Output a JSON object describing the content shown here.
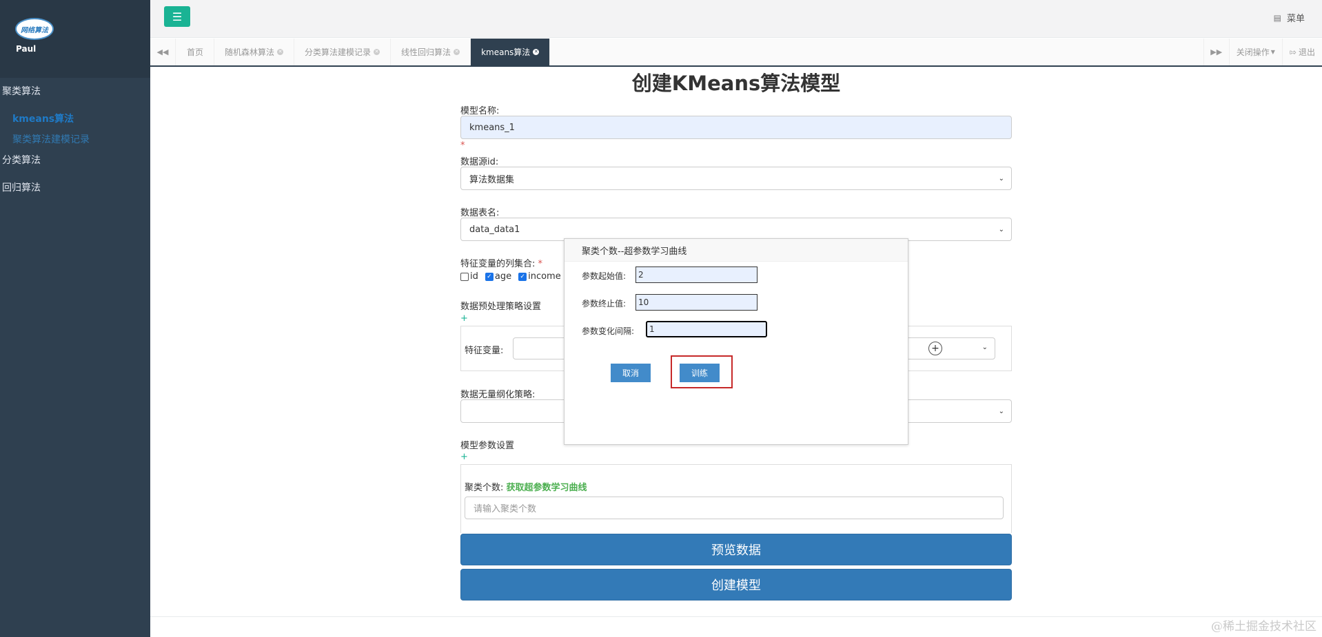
{
  "sidebar": {
    "logo_text": "网络算法",
    "username": "Paul",
    "groups": [
      {
        "label": "聚类算法",
        "items": [
          {
            "label": "kmeans算法"
          },
          {
            "label": "聚类算法建模记录"
          }
        ]
      },
      {
        "label": "分类算法"
      },
      {
        "label": "回归算法"
      }
    ]
  },
  "topbar": {
    "menu_label": "菜单"
  },
  "tabs": [
    {
      "label": "首页"
    },
    {
      "label": "随机森林算法"
    },
    {
      "label": "分类算法建模记录"
    },
    {
      "label": "线性回归算法"
    },
    {
      "label": "kmeans算法"
    }
  ],
  "tabs_right": {
    "close_ops": "关闭操作",
    "logout": "退出"
  },
  "form": {
    "title": "创建KMeans算法模型",
    "model_name_label": "模型名称:",
    "model_name_value": "kmeans_1",
    "datasource_label": "数据源id:",
    "datasource_value": "算法数据集",
    "table_label": "数据表名:",
    "table_value": "data_data1",
    "features_label": "特征变量的列集合:",
    "feature_options": [
      {
        "name": "id",
        "checked": false
      },
      {
        "name": "age",
        "checked": true
      },
      {
        "name": "income",
        "checked": true
      }
    ],
    "preprocess_label": "数据预处理策略设置",
    "add_symbol": "+",
    "feature_var_label": "特征变量:",
    "normalize_label": "数据无量纲化策略:",
    "params_label": "模型参数设置",
    "clusters_label": "聚类个数:",
    "curve_link": "获取超参数学习曲线",
    "clusters_placeholder": "请输入聚类个数",
    "preview_button": "预览数据",
    "create_button": "创建模型"
  },
  "modal": {
    "title": "聚类个数--超参数学习曲线",
    "start_label": "参数起始值:",
    "start_value": "2",
    "end_label": "参数终止值:",
    "end_value": "10",
    "step_label": "参数变化间隔:",
    "step_value": "1",
    "cancel_button": "取消",
    "train_button": "训练"
  },
  "watermark": "@稀土掘金技术社区",
  "colors": {
    "sidebar": "#2f4050",
    "accent": "#1ab394",
    "primary": "#337ab7",
    "highlight": "#c62828"
  }
}
